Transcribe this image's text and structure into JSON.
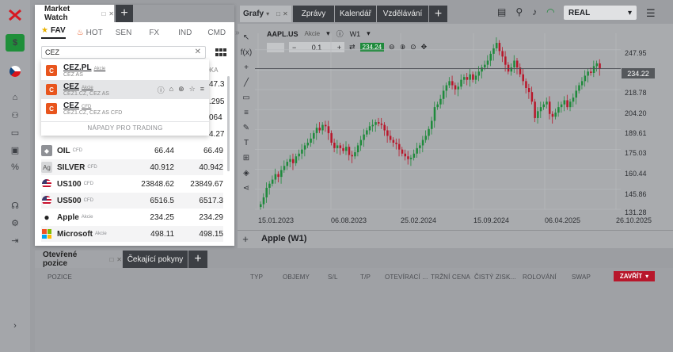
{
  "top_tabs": {
    "grafy": "Grafy",
    "zpravy": "Zprávy",
    "kalendar": "Kalendář",
    "vzdelavani": "Vzdělávání"
  },
  "account": {
    "label": "REAL"
  },
  "market_watch": {
    "title": "Market Watch",
    "categories": [
      "FAV",
      "HOT",
      "SEN",
      "FX",
      "IND",
      "CMD"
    ],
    "search": {
      "value": "CEZ"
    },
    "col_ask_partial": "DKA",
    "rows": [
      {
        "name": "OIL",
        "tag": "CFD",
        "bid": "66.44",
        "ask": "66.49",
        "icon": "oil-drop-icon"
      },
      {
        "name": "SILVER",
        "tag": "CFD",
        "bid": "40.912",
        "ask": "40.942",
        "icon": "silver-ag-icon"
      },
      {
        "name": "US100",
        "tag": "CFD",
        "bid": "23848.62",
        "ask": "23849.67",
        "icon": "us-flag-icon"
      },
      {
        "name": "US500",
        "tag": "CFD",
        "bid": "6516.5",
        "ask": "6517.3",
        "icon": "us-flag-icon"
      },
      {
        "name": "Apple",
        "tag": "Akcie",
        "bid": "234.25",
        "ask": "234.29",
        "icon": "apple-icon"
      },
      {
        "name": "Microsoft",
        "tag": "Akcie",
        "bid": "498.11",
        "ask": "498.15",
        "icon": "microsoft-icon"
      }
    ],
    "hidden_partials": [
      "47.3",
      ".295",
      "064",
      "4.27"
    ]
  },
  "search_dropdown": {
    "items": [
      {
        "name": "CEZ.PL",
        "tag": "Akcie",
        "desc": "CEZ AS"
      },
      {
        "name": "CEZ",
        "tag": "Akcie",
        "desc": "CEZ1.CZ, CEZ AS"
      },
      {
        "name": "CEZ",
        "tag": "CFD",
        "desc": "CEZ1.CZ, CEZ AS CFD"
      }
    ],
    "footer": "NÁPADY PRO TRADING"
  },
  "chart": {
    "symbol": "AAPL.US",
    "symbol_type": "Akcie",
    "timeframe": "W1",
    "lot": "0.1",
    "buy_price": "234.24",
    "current_price_tag": "234.22",
    "bottom_title": "Apple (W1)"
  },
  "chart_data": {
    "type": "candlestick",
    "title": "",
    "series_name": "AAPL.US",
    "xlabel": "",
    "ylabel": "",
    "y_ticks": [
      247.95,
      233.09,
      218.78,
      204.2,
      189.61,
      175.03,
      160.44,
      145.86,
      131.28
    ],
    "x_ticks": [
      "15.01.2023",
      "06.08.2023",
      "25.02.2024",
      "15.09.2024",
      "06.04.2025",
      "26.10.2025"
    ],
    "ylim": [
      131.28,
      260
    ],
    "last_price": 234.22,
    "grid": true,
    "weekly_close": [
      135,
      140,
      147,
      150,
      153,
      157,
      155,
      160,
      163,
      166,
      168,
      165,
      170,
      172,
      175,
      178,
      180,
      183,
      187,
      191,
      189,
      193,
      192,
      187,
      180,
      176,
      178,
      176,
      174,
      177,
      171,
      170,
      173,
      178,
      182,
      186,
      189,
      192,
      193,
      195,
      194,
      193,
      189,
      185,
      182,
      180,
      179,
      175,
      172,
      170,
      168,
      169,
      172,
      176,
      178,
      182,
      185,
      190,
      196,
      206,
      208,
      212,
      218,
      222,
      225,
      222,
      219,
      221,
      226,
      228,
      226,
      230,
      226,
      229,
      232,
      235,
      237,
      240,
      245,
      249,
      253,
      247,
      243,
      237,
      232,
      235,
      240,
      235,
      230,
      225,
      220,
      217,
      210,
      198,
      203,
      206,
      208,
      210,
      201,
      199,
      202,
      206,
      208,
      211,
      206,
      210,
      213,
      218,
      222,
      225,
      229,
      232,
      231,
      236,
      238,
      234
    ]
  },
  "bottom_panel": {
    "tab_open": "Otevřené pozice",
    "tab_pending": "Čekající pokyny",
    "columns": [
      "POZICE",
      "TYP",
      "OBJEMY",
      "S/L",
      "T/P",
      "OTEVÍRACÍ ...",
      "TRŽNÍ CENA",
      "ČISTÝ ZISK...",
      "ROLOVÁNÍ",
      "SWAP"
    ],
    "close_button": "ZAVŘÍT"
  },
  "colors": {
    "buy_green": "#1f8a3c",
    "sell_red": "#b8172b",
    "candle_up": "#1f8a3c",
    "candle_down": "#b8172b",
    "cez_orange": "#e8551d"
  }
}
